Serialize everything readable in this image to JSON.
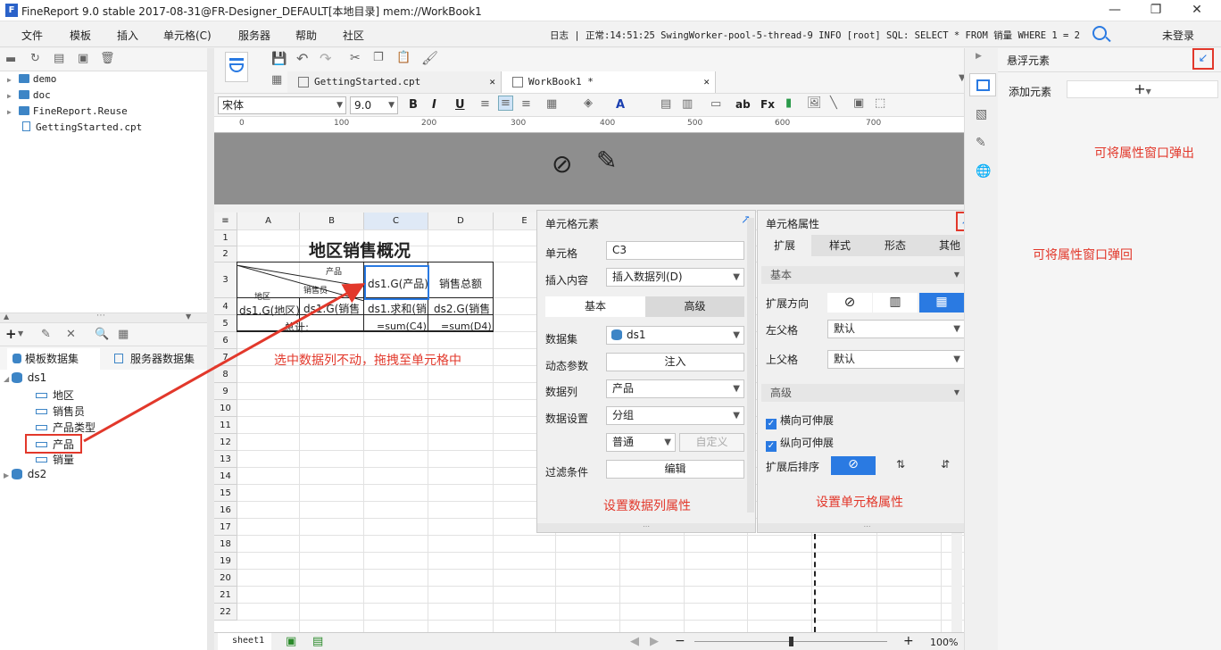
{
  "window": {
    "title": "FineReport 9.0 stable 2017-08-31@FR-Designer_DEFAULT[本地目录]    mem://WorkBook1",
    "logo": "F"
  },
  "menu": {
    "items": [
      "文件",
      "模板",
      "插入",
      "单元格(C)",
      "服务器",
      "帮助",
      "社区"
    ],
    "log": "日志 | 正常:14:51:25 SwingWorker-pool-5-thread-9 INFO [root] SQL: SELECT * FROM 销量 WHERE 1 = 2",
    "login": "未登录"
  },
  "file_tree": {
    "items": [
      "demo",
      "doc",
      "FineReport.Reuse",
      "GettingStarted.cpt"
    ]
  },
  "dataset_tabs": [
    "模板数据集",
    "服务器数据集"
  ],
  "datasets": {
    "ds1": "ds1",
    "fields": [
      "地区",
      "销售员",
      "产品类型",
      "产品",
      "销量"
    ],
    "ds2": "ds2"
  },
  "file_tabs": [
    "GettingStarted.cpt",
    "WorkBook1 *"
  ],
  "format": {
    "font": "宋体",
    "size": "9.0"
  },
  "ruler_ticks": [
    "0",
    "100",
    "200",
    "300",
    "400",
    "500",
    "600",
    "700"
  ],
  "sheet": {
    "columns": [
      "A",
      "B",
      "C",
      "D",
      "E"
    ],
    "rows": [
      "1",
      "2",
      "3",
      "4",
      "5",
      "6",
      "7",
      "8",
      "9",
      "10",
      "11",
      "12",
      "13",
      "14",
      "15",
      "16",
      "17",
      "18",
      "19",
      "20",
      "21",
      "22"
    ],
    "title": "地区销售概况",
    "slash_labels": [
      "产品",
      "销售员",
      "地区"
    ],
    "c3": "ds1.G(产品)",
    "d3": "销售总额",
    "row4": [
      "ds1.G(地区)",
      "ds1.G(销售",
      "ds1.求和(销",
      "ds2.G(销售"
    ],
    "row5": [
      "总计:",
      "=sum(C4)",
      "=sum(D4)"
    ],
    "tab": "sheet1",
    "zoom": "100%"
  },
  "cell_elem": {
    "title": "单元格元素",
    "cell_label": "单元格",
    "cell_value": "C3",
    "insert_label": "插入内容",
    "insert_value": "插入数据列(D)",
    "tab_basic": "基本",
    "tab_adv": "高级",
    "dataset_label": "数据集",
    "dataset_value": "ds1",
    "dyn_label": "动态参数",
    "dyn_btn": "注入",
    "col_label": "数据列",
    "col_value": "产品",
    "setting_label": "数据设置",
    "setting_value": "分组",
    "mode_value": "普通",
    "custom_btn": "自定义",
    "filter_label": "过滤条件",
    "filter_btn": "编辑"
  },
  "cell_prop": {
    "title": "单元格属性",
    "tabs": [
      "扩展",
      "样式",
      "形态",
      "其他"
    ],
    "sec_basic": "基本",
    "dir_label": "扩展方向",
    "left_label": "左父格",
    "left_value": "默认",
    "top_label": "上父格",
    "top_value": "默认",
    "sec_adv": "高级",
    "h_expand": "横向可伸展",
    "v_expand": "纵向可伸展",
    "sort_label": "扩展后排序"
  },
  "float_panel": {
    "title": "悬浮元素",
    "add_label": "添加元素"
  },
  "annotations": {
    "drag": "选中数据列不动，拖拽至单元格中",
    "set_col": "设置数据列属性",
    "set_cell": "设置单元格属性",
    "popin": "可将属性窗口弹回",
    "popout": "可将属性窗口弹出"
  },
  "colors": {
    "accent": "#2a7ae2",
    "annotation": "#e2382b",
    "selection": "#2a7ae2"
  }
}
